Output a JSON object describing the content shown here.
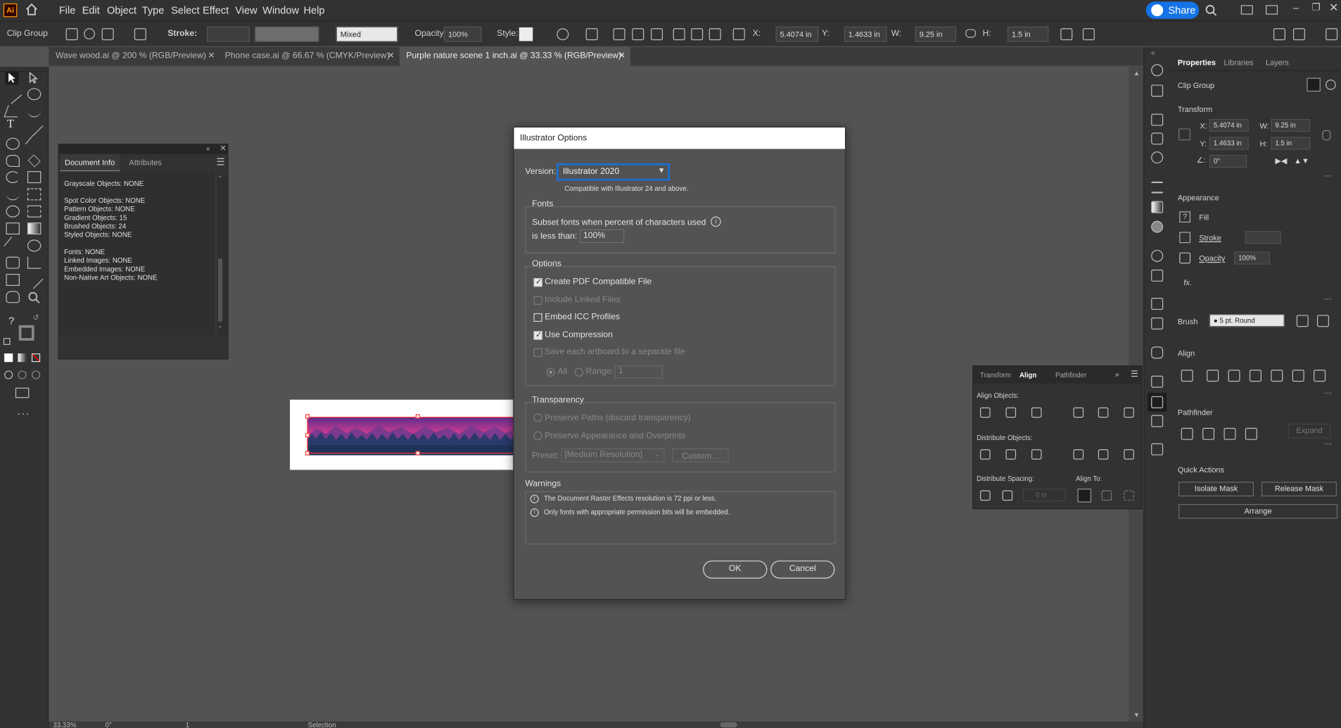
{
  "app": {
    "logo": "Ai"
  },
  "menu": [
    "File",
    "Edit",
    "Object",
    "Type",
    "Select",
    "Effect",
    "View",
    "Window",
    "Help"
  ],
  "share_label": "Share",
  "control_bar": {
    "selection_type": "Clip Group",
    "stroke_label": "Stroke:",
    "mixed_value": "Mixed",
    "opacity_label": "Opacity:",
    "opacity_value": "100%",
    "style_label": "Style:",
    "x_label": "X:",
    "x_value": "5.4074 in",
    "y_label": "Y:",
    "y_value": "1.4633 in",
    "w_label": "W:",
    "w_value": "9.25 in",
    "h_label": "H:",
    "h_value": "1.5 in"
  },
  "tabs": [
    {
      "label": "Wave wood.ai @ 200 % (RGB/Preview)"
    },
    {
      "label": "Phone case.ai @ 66.67 % (CMYK/Preview)"
    },
    {
      "label": "Purple nature scene 1 inch.ai @ 33.33 % (RGB/Preview)",
      "active": true
    }
  ],
  "doc_info": {
    "tab_active": "Document Info",
    "tab_other": "Attributes",
    "lines": [
      "Grayscale Objects: NONE",
      "Spot Color Objects: NONE",
      "Pattern Objects: NONE",
      "Gradient Objects: 15",
      "Brushed Objects: 24",
      "Styled Objects: NONE",
      "Fonts: NONE",
      "Linked Images: NONE",
      "Embedded Images: NONE",
      "Non-Native Art Objects: NONE"
    ]
  },
  "dialog": {
    "title": "Illustrator Options",
    "version_label": "Version:",
    "version_value": "Illustrator 2020",
    "compat_note": "Compatible with Illustrator 24 and above.",
    "fonts_header": "Fonts",
    "subset_line1": "Subset fonts when percent of characters used",
    "subset_line2": "is less than:",
    "subset_value": "100%",
    "options_header": "Options",
    "opt_pdf": "Create PDF Compatible File",
    "opt_linked": "Include Linked Files",
    "opt_icc": "Embed ICC Profiles",
    "opt_compress": "Use Compression",
    "opt_artboard": "Save each artboard to a separate file",
    "radio_all": "All",
    "radio_range": "Range:",
    "range_value": "1",
    "transparency_header": "Transparency",
    "preserve_paths": "Preserve Paths (discard transparency)",
    "preserve_appearance": "Preserve Appearance and Overprints",
    "preset_label": "Preset:",
    "preset_value": "[Medium Resolution]",
    "custom_label": "Custom...",
    "warnings_header": "Warnings",
    "warning1": "The Document Raster Effects resolution is 72 ppi or less.",
    "warning2": "Only fonts with appropriate permission bits will be embedded.",
    "ok_label": "OK",
    "cancel_label": "Cancel"
  },
  "align_panel": {
    "tab_transform": "Transform",
    "tab_align": "Align",
    "tab_pathfinder": "Pathfinder",
    "align_objects": "Align Objects:",
    "distribute_objects": "Distribute Objects:",
    "distribute_spacing": "Distribute Spacing:",
    "align_to": "Align To:",
    "spacing_value": "0 in"
  },
  "properties": {
    "tab_properties": "Properties",
    "tab_libraries": "Libraries",
    "tab_layers": "Layers",
    "selection": "Clip Group",
    "transform_header": "Transform",
    "x_label": "X:",
    "x_value": "5.4074 in",
    "y_label": "Y:",
    "y_value": "1.4633 in",
    "w_label": "W:",
    "w_value": "9.25 in",
    "h_label": "H:",
    "h_value": "1.5 in",
    "angle_value": "0°",
    "appearance_header": "Appearance",
    "fill_label": "Fill",
    "stroke_label": "Stroke",
    "opacity_label": "Opacity",
    "opacity_value": "100%",
    "fx_label": "fx.",
    "brush_label": "Brush",
    "brush_value": "5 pt. Round",
    "align_header": "Align",
    "pathfinder_header": "Pathfinder",
    "expand_label": "Expand",
    "quick_actions_header": "Quick Actions",
    "isolate_mask": "Isolate Mask",
    "release_mask": "Release Mask",
    "arrange": "Arrange"
  },
  "status": {
    "zoom": "33.33%",
    "rotation": "0°",
    "artboard": "1",
    "tool": "Selection"
  },
  "colors": {
    "accent": "#1473e6",
    "ui_dark": "#323232",
    "canvas": "#535353",
    "logo": "#ff9a00"
  }
}
